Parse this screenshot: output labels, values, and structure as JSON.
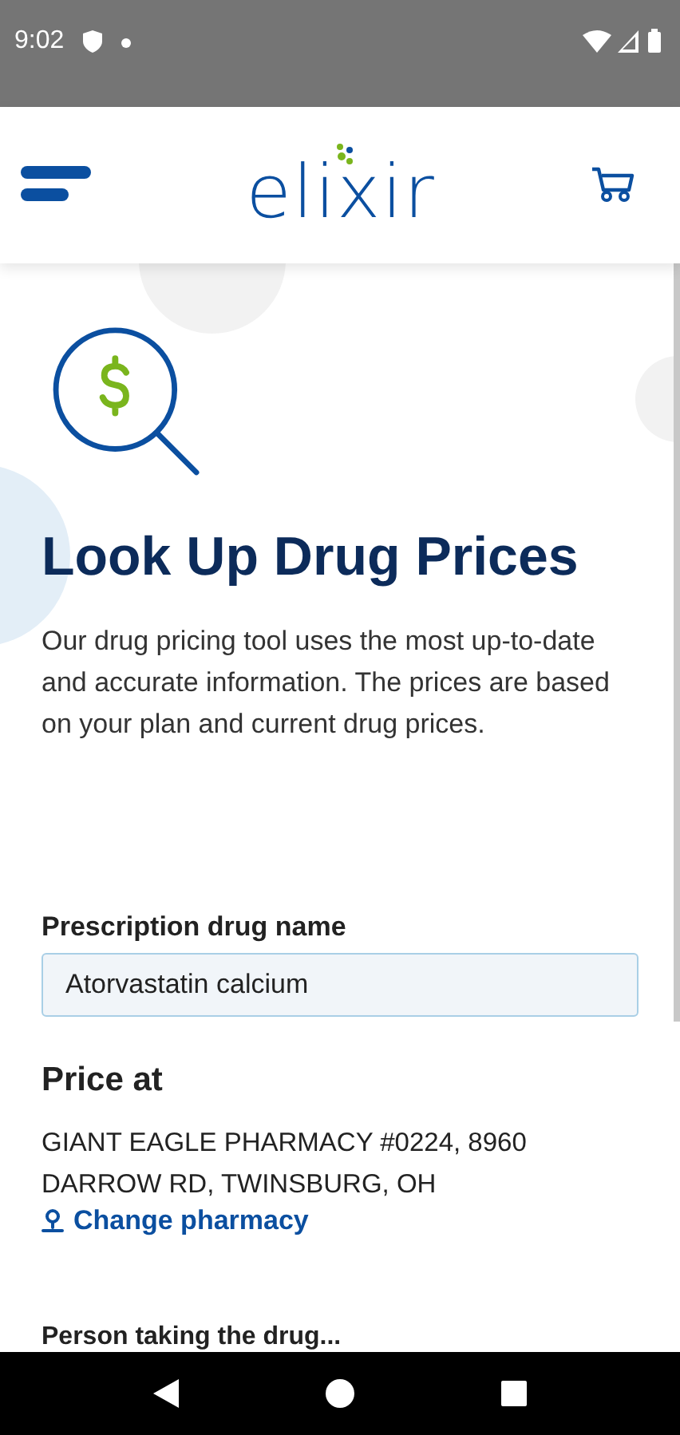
{
  "status_bar": {
    "time": "9:02"
  },
  "header": {
    "logo": "elixir"
  },
  "page": {
    "title": "Look Up Drug Prices",
    "description": "Our drug pricing tool uses the most up-to-date and accurate information. The prices are based on your plan and current drug prices."
  },
  "drug_field": {
    "label": "Prescription drug name",
    "value": "Atorvastatin calcium"
  },
  "price_at": {
    "heading": "Price at",
    "pharmacy": "GIANT EAGLE PHARMACY #0224, 8960 DARROW RD, TWINSBURG, OH",
    "link": "Change pharmacy"
  },
  "next_section": {
    "label": "Person taking the drug..."
  }
}
